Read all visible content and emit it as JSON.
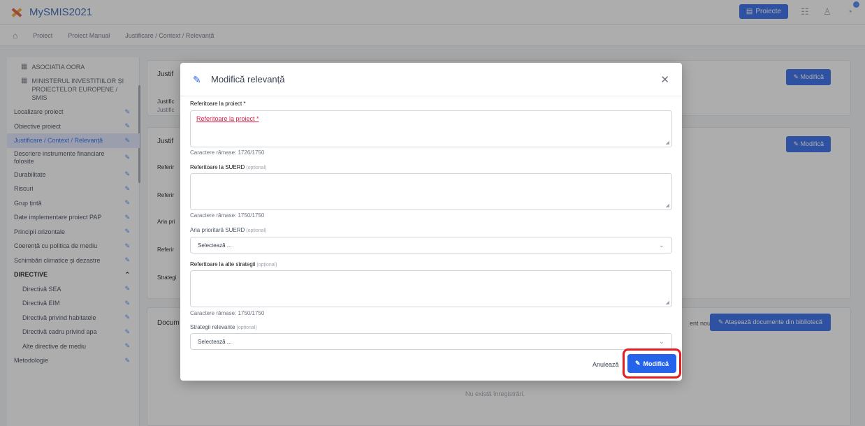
{
  "app": {
    "title": "MySMIS2021",
    "projects_button": "Proiecte"
  },
  "breadcrumb": [
    "Proiect",
    "Proiect Manual",
    "Justificare / Context / Relevanță"
  ],
  "sidebar": {
    "orgs": [
      "ASOCIATIA OORA",
      "MINISTERUL INVESTITIILOR ȘI PROIECTELOR EUROPENE / SMIS"
    ],
    "items": [
      "Localizare proiect",
      "Obiective proiect",
      "Justificare / Context / Relevanță",
      "Descriere instrumente financiare folosite",
      "Durabilitate",
      "Riscuri",
      "Grup țintă",
      "Date implementare proiect PAP",
      "Principii orizontale",
      "Coerență cu politica de mediu",
      "Schimbări climatice și dezastre",
      "DIRECTIVE",
      "Directivă SEA",
      "Directivă EIM",
      "Directivă privind habitatele",
      "Directivă cadru privind apa",
      "Alte directive de mediu",
      "Metodologie"
    ]
  },
  "main": {
    "card1_title": "Justif",
    "card1_rows": [
      "Justific",
      "Justific"
    ],
    "card2_title": "Justif",
    "card2_rows": [
      "Referir",
      "Referir",
      "Aria pri",
      "Referir",
      "Strategi"
    ],
    "card3_title": "Docum",
    "modify_label": "Modifică",
    "card3_link": "ent nou",
    "attach_button": "Atașează documente din bibliotecă",
    "empty": "Nu există înregistrări."
  },
  "modal": {
    "title": "Modifică relevanță",
    "field1_label": "Referitoare la proiect *",
    "field1_value": "Referitoare la proiect *",
    "field1_counter": "Caractere rămase: 1726/1750",
    "field2_label": "Referitoare la SUERD",
    "field2_counter": "Caractere rămase: 1750/1750",
    "field3_label": "Aria prioritară SUERD",
    "field3_value": "Selectează ...",
    "field4_label": "Referitoare la alte strategii",
    "field4_counter": "Caractere rămase: 1750/1750",
    "field5_label": "Strategii relevante",
    "field5_value": "Selectează ...",
    "optional": "(opțional)",
    "cancel": "Anulează",
    "submit": "Modifică"
  },
  "colors": {
    "primary": "#2563eb",
    "highlight": "#e11d1d"
  }
}
